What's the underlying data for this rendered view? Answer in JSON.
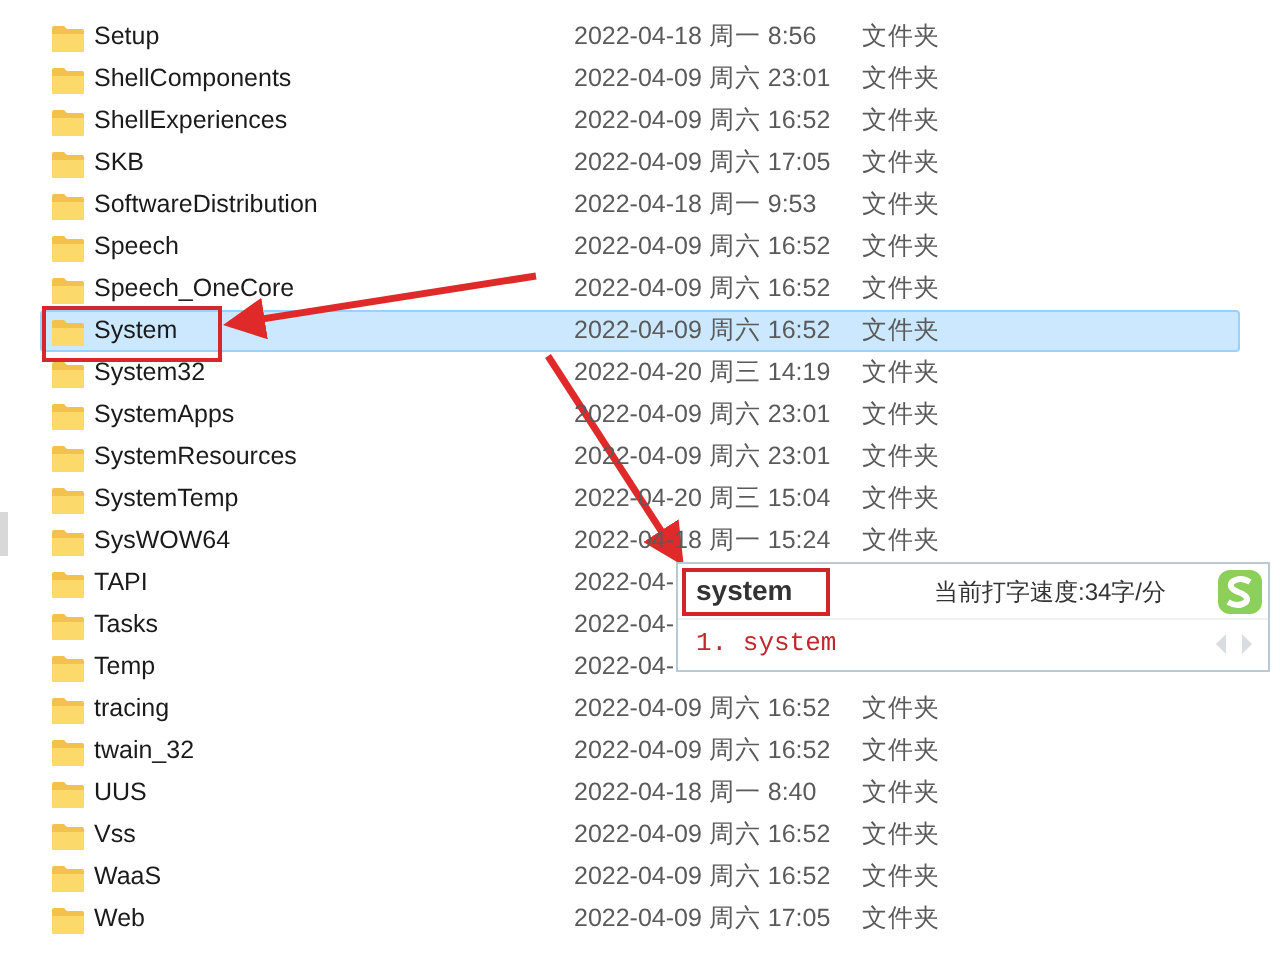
{
  "files": [
    {
      "name": "Setup",
      "date": "2022-04-18 周一 8:56",
      "type": "文件夹",
      "selected": false
    },
    {
      "name": "ShellComponents",
      "date": "2022-04-09 周六 23:01",
      "type": "文件夹",
      "selected": false
    },
    {
      "name": "ShellExperiences",
      "date": "2022-04-09 周六 16:52",
      "type": "文件夹",
      "selected": false
    },
    {
      "name": "SKB",
      "date": "2022-04-09 周六 17:05",
      "type": "文件夹",
      "selected": false
    },
    {
      "name": "SoftwareDistribution",
      "date": "2022-04-18 周一 9:53",
      "type": "文件夹",
      "selected": false
    },
    {
      "name": "Speech",
      "date": "2022-04-09 周六 16:52",
      "type": "文件夹",
      "selected": false
    },
    {
      "name": "Speech_OneCore",
      "date": "2022-04-09 周六 16:52",
      "type": "文件夹",
      "selected": false
    },
    {
      "name": "System",
      "date": "2022-04-09 周六 16:52",
      "type": "文件夹",
      "selected": true
    },
    {
      "name": "System32",
      "date": "2022-04-20 周三 14:19",
      "type": "文件夹",
      "selected": false
    },
    {
      "name": "SystemApps",
      "date": "2022-04-09 周六 23:01",
      "type": "文件夹",
      "selected": false
    },
    {
      "name": "SystemResources",
      "date": "2022-04-09 周六 23:01",
      "type": "文件夹",
      "selected": false
    },
    {
      "name": "SystemTemp",
      "date": "2022-04-20 周三 15:04",
      "type": "文件夹",
      "selected": false
    },
    {
      "name": "SysWOW64",
      "date": "2022-04-18 周一 15:24",
      "type": "文件夹",
      "selected": false
    },
    {
      "name": "TAPI",
      "date": "2022-04-",
      "selected": false
    },
    {
      "name": "Tasks",
      "date": "2022-04-",
      "selected": false
    },
    {
      "name": "Temp",
      "date": "2022-04-",
      "selected": false
    },
    {
      "name": "tracing",
      "date": "2022-04-09 周六 16:52",
      "type": "文件夹",
      "selected": false
    },
    {
      "name": "twain_32",
      "date": "2022-04-09 周六 16:52",
      "type": "文件夹",
      "selected": false
    },
    {
      "name": "UUS",
      "date": "2022-04-18 周一 8:40",
      "type": "文件夹",
      "selected": false
    },
    {
      "name": "Vss",
      "date": "2022-04-09 周六 16:52",
      "type": "文件夹",
      "selected": false
    },
    {
      "name": "WaaS",
      "date": "2022-04-09 周六 16:52",
      "type": "文件夹",
      "selected": false
    },
    {
      "name": "Web",
      "date": "2022-04-09 周六 17:05",
      "type": "文件夹",
      "selected": false
    }
  ],
  "ime": {
    "input": "system",
    "speed": "当前打字速度:34字/分",
    "candidates": [
      "1. system"
    ]
  }
}
